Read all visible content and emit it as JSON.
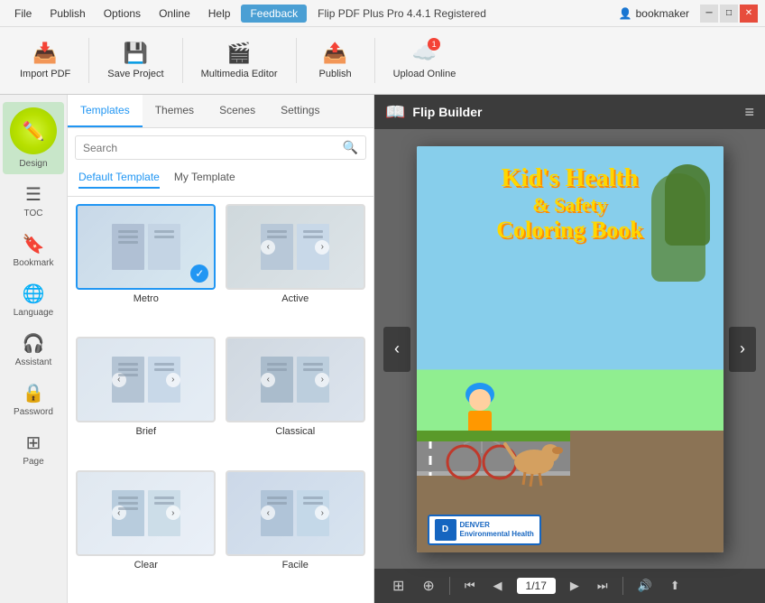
{
  "titlebar": {
    "menu_items": [
      "File",
      "Publish",
      "Options",
      "Online",
      "Help"
    ],
    "feedback_label": "Feedback",
    "app_title": "Flip PDF Plus Pro 4.4.1 Registered",
    "user_icon": "👤",
    "user_name": "bookmaker",
    "minimize": "─",
    "maximize": "□",
    "close": "✕"
  },
  "toolbar": {
    "import_pdf": "Import PDF",
    "save_project": "Save Project",
    "multimedia_editor": "Multimedia Editor",
    "publish": "Publish",
    "upload_online": "Upload Online"
  },
  "sidebar": {
    "items": [
      {
        "id": "design",
        "label": "Design",
        "icon": "✏️"
      },
      {
        "id": "toc",
        "label": "TOC",
        "icon": "☰"
      },
      {
        "id": "bookmark",
        "label": "Bookmark",
        "icon": "🔖"
      },
      {
        "id": "language",
        "label": "Language",
        "icon": "🌐"
      },
      {
        "id": "assistant",
        "label": "Assistant",
        "icon": "🎧"
      },
      {
        "id": "password",
        "label": "Password",
        "icon": "🔒"
      },
      {
        "id": "page",
        "label": "Page",
        "icon": "⊞"
      }
    ]
  },
  "panel": {
    "tabs": [
      "Templates",
      "Themes",
      "Scenes",
      "Settings"
    ],
    "active_tab": "Templates",
    "search_placeholder": "Search",
    "subtabs": [
      "Default Template",
      "My Template"
    ],
    "active_subtab": "Default Template",
    "templates": [
      {
        "id": "metro",
        "label": "Metro",
        "selected": true
      },
      {
        "id": "active",
        "label": "Active",
        "selected": false
      },
      {
        "id": "brief",
        "label": "Brief",
        "selected": false
      },
      {
        "id": "classical",
        "label": "Classical",
        "selected": false
      },
      {
        "id": "clear",
        "label": "Clear",
        "selected": false
      },
      {
        "id": "facile",
        "label": "Facile",
        "selected": false
      }
    ]
  },
  "preview": {
    "header_title": "Flip Builder",
    "book_title_line1": "Kid's Health",
    "book_title_line2": "& Safety",
    "book_title_line3": "Coloring Book",
    "page_current": "1",
    "page_total": "17",
    "page_indicator": "1/17",
    "denver_line1": "DENVER",
    "denver_line2": "Environmental Health"
  },
  "bottom_toolbar": {
    "grid_icon": "⊞",
    "zoom_in_icon": "⊕",
    "first_icon": "⏮",
    "prev_icon": "◀",
    "next_icon": "▶",
    "last_icon": "⏭",
    "volume_icon": "🔊",
    "share_icon": "⬆"
  }
}
